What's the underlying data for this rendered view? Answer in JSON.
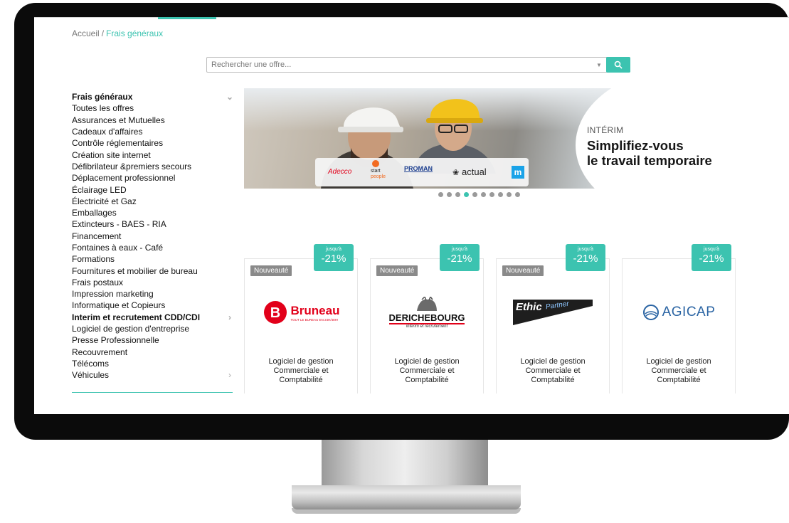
{
  "breadcrumb": {
    "home": "Accueil",
    "separator": "/",
    "current": "Frais généraux"
  },
  "search": {
    "placeholder": "Rechercher une offre...",
    "button_icon": "search-icon"
  },
  "sidebar": {
    "items": [
      {
        "label": "Frais généraux",
        "bold": true,
        "icon": "chevron-down-icon"
      },
      {
        "label": "Toutes les offres"
      },
      {
        "label": "Assurances et Mutuelles"
      },
      {
        "label": "Cadeaux d'affaires"
      },
      {
        "label": "Contrôle réglementaires"
      },
      {
        "label": "Création site internet"
      },
      {
        "label": "Défibrilateur &premiers secours"
      },
      {
        "label": "Déplacement professionnel"
      },
      {
        "label": "Éclairage LED"
      },
      {
        "label": "Électricité et Gaz"
      },
      {
        "label": "Emballages"
      },
      {
        "label": "Extincteurs - BAES - RIA"
      },
      {
        "label": "Financement"
      },
      {
        "label": "Fontaines à eaux - Café"
      },
      {
        "label": "Formations"
      },
      {
        "label": "Fournitures et mobilier de bureau"
      },
      {
        "label": "Frais postaux"
      },
      {
        "label": "Impression marketing"
      },
      {
        "label": "Informatique et Copieurs"
      },
      {
        "label": "Interim et recrutement CDD/CDI",
        "bold": true,
        "icon": "chevron-right-icon"
      },
      {
        "label": "Logiciel de gestion d'entreprise"
      },
      {
        "label": "Presse Professionnelle"
      },
      {
        "label": "Recouvrement"
      },
      {
        "label": "Télécoms"
      },
      {
        "label": "Véhicules",
        "icon": "chevron-right-icon"
      }
    ]
  },
  "banner": {
    "kicker": "INTÉRIM",
    "title_line1": "Simplifiez-vous",
    "title_line2": "le travail temporaire",
    "partner_logos": [
      "Adecco",
      "start",
      "people",
      "PROMAN",
      "actual",
      "m"
    ],
    "carousel_dot_count": 10,
    "carousel_active_index": 3
  },
  "cards": [
    {
      "badge": "Nouveauté",
      "promo_small": "jusqu'à",
      "promo_value": "-21%",
      "logo_text": "Bruneau",
      "logo_subtext": "TOUT LE BUREAU EN 24H/48H!",
      "description": [
        "Logiciel de gestion",
        "Commerciale et",
        "Comptabilité"
      ]
    },
    {
      "badge": "Nouveauté",
      "promo_small": "jusqu'à",
      "promo_value": "-21%",
      "logo_text": "DERICHEBOURG",
      "logo_subtext": "intérim et recrutement",
      "description": [
        "Logiciel de gestion",
        "Commerciale et",
        "Comptabilité"
      ]
    },
    {
      "badge": "Nouveauté",
      "promo_small": "jusqu'à",
      "promo_value": "-21%",
      "logo_text": "Ethic",
      "logo_subtext": "Partner",
      "description": [
        "Logiciel de gestion",
        "Commerciale et",
        "Comptabilité"
      ]
    },
    {
      "badge": "",
      "promo_small": "jusqu'à",
      "promo_value": "-21%",
      "logo_text": "AGICAP",
      "logo_subtext": "",
      "description": [
        "Logiciel de gestion",
        "Commerciale et",
        "Comptabilité"
      ]
    }
  ],
  "colors": {
    "accent": "#3cc3b0",
    "badge": "#8a8a8a",
    "bruneau_red": "#e2001a",
    "agicap_blue": "#2a64a3"
  }
}
